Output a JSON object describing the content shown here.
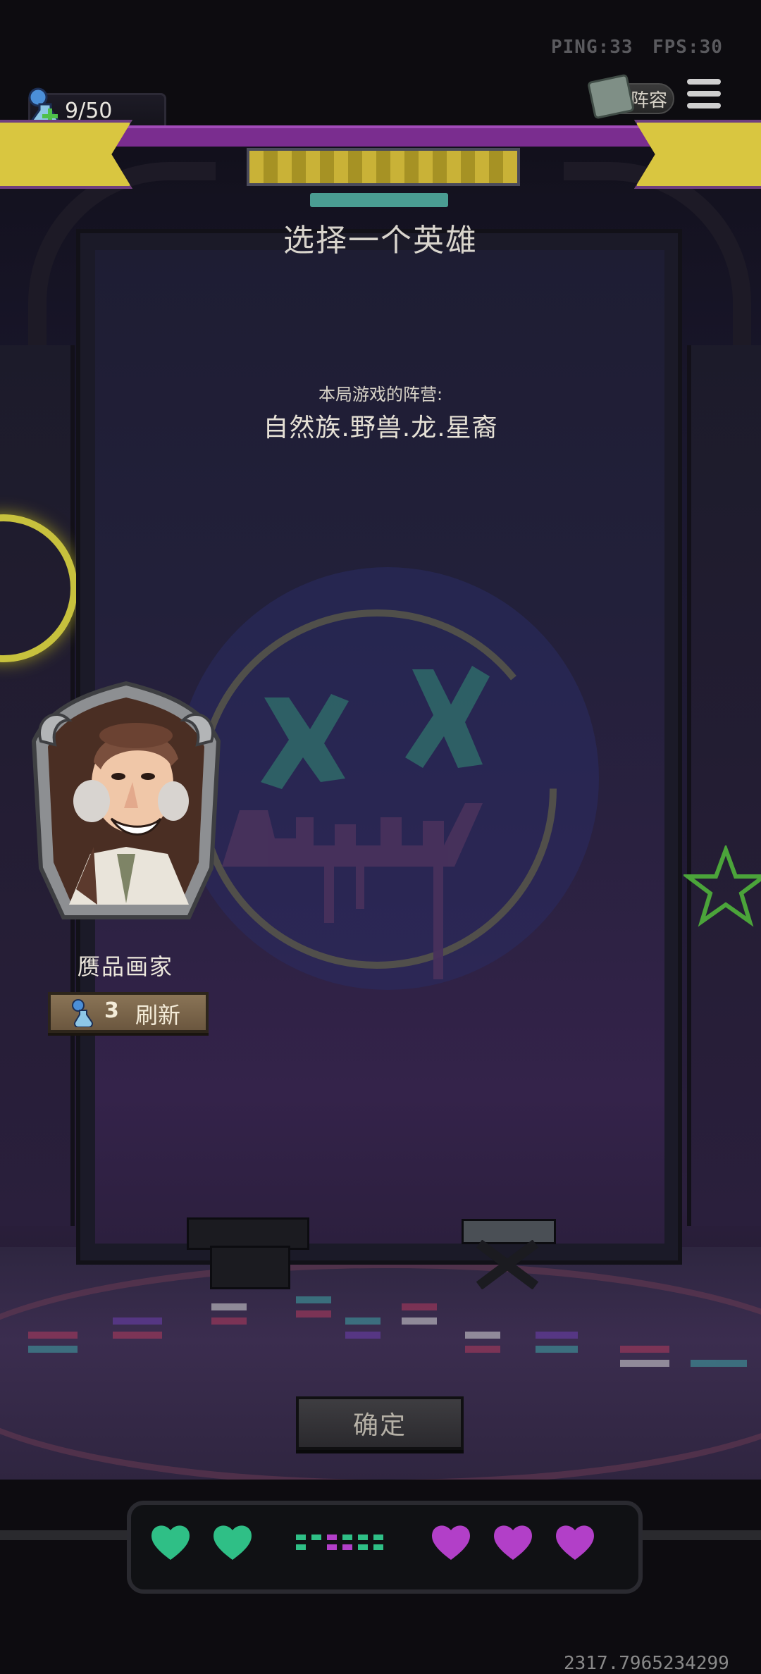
{
  "hud": {
    "ping": "PING:33",
    "fps": "FPS:30",
    "gold": "9/50",
    "lineup_label": "阵容"
  },
  "panel": {
    "title": "选择一个英雄",
    "faction_label": "本局游戏的阵营:",
    "faction_value": "自然族.野兽.龙.星裔"
  },
  "hero": {
    "name": "赝品画家",
    "refresh_cost": "3",
    "refresh_label": "刷新"
  },
  "confirm_label": "确定",
  "lives": {
    "green_hearts": 2,
    "purple_hearts": 3,
    "green_color": "#2fbf86",
    "purple_color": "#b23fc8"
  },
  "debug_coords": "2317.7965234299"
}
